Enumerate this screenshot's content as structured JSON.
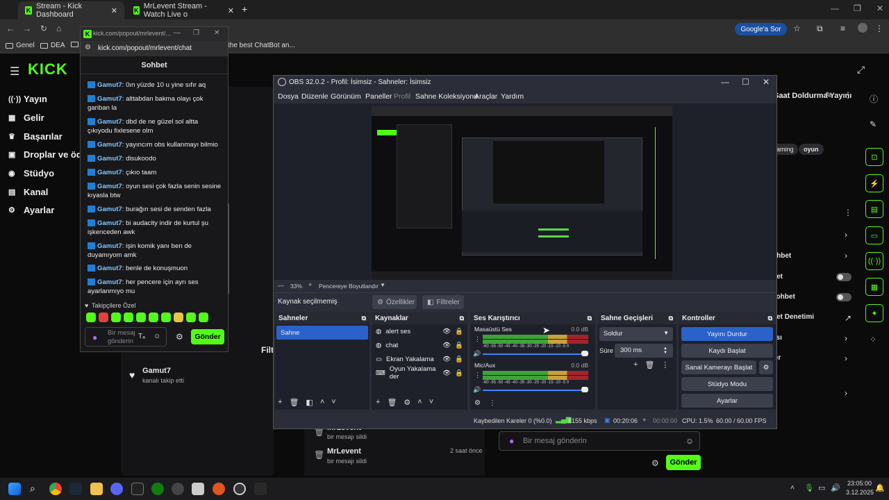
{
  "browser": {
    "tabs": [
      {
        "label": "Stream - Kick Dashboard"
      },
      {
        "label": "MrLevent Stream - Watch Live o"
      }
    ],
    "bookmarks": [
      "Genel",
      "DEA",
      "the best ChatBot an..."
    ],
    "google_btn": "Google'a Sor"
  },
  "popout": {
    "url_short": "kick.com/popout/mrlevent/...",
    "url": "kick.com/popout/mrlevent/chat",
    "title": "Sohbet",
    "messages": [
      {
        "user": "Gamut7",
        "text": ": 0ın yüzde 10 u yine sıfır aq"
      },
      {
        "user": "Gamut7",
        "text": ": alttabdan bakma olayı çok gariban la"
      },
      {
        "user": "Gamut7",
        "text": ": dbd de ne güzel sol altta çıkıyodu fixlesene olm"
      },
      {
        "user": "Gamut7",
        "text": ": yayıncım obs kullanmayı bilmio"
      },
      {
        "user": "Gamut7",
        "text": ": disukoodo"
      },
      {
        "user": "Gamut7",
        "text": ": çıkıo taam"
      },
      {
        "user": "Gamut7",
        "text": ": oyun sesi çok fazla senin sesine kıyasla btw"
      },
      {
        "user": "Gamut7",
        "text": ": burağın sesi de senden fazla"
      },
      {
        "user": "Gamut7",
        "text": ": bi audacity indir de kurtul şu işkenceden awk"
      },
      {
        "user": "Gamut7",
        "text": ": işin komik yanı ben de duyamıyom amk"
      },
      {
        "user": "Gamut7",
        "text": ": benle de konuşmuon"
      },
      {
        "user": "Gamut7",
        "text": ": her pencere için ayrı ses ayarlanmıyo mu"
      }
    ],
    "followers_label": "Takipçilere Özel",
    "input_placeholder": "Bir mesaj gönderin",
    "send": "Gönder"
  },
  "kick": {
    "logo": "KICK",
    "nav": [
      "Yayın",
      "Gelir",
      "Başarılar",
      "Droplar ve ödüll",
      "Stüdyo",
      "Kanal",
      "Ayarlar"
    ],
    "stream_title": "Saat Doldurma Yayını",
    "tags": [
      "aming",
      "oyun"
    ],
    "activity": [
      {
        "name": "Gamut7",
        "desc": "kanalı takip etti",
        "time": ""
      },
      {
        "name": "MrLevent",
        "desc": "bir mesajı sildi",
        "time": ""
      },
      {
        "name": "MrLevent",
        "desc": "bir mesajı sildi",
        "time": "2 saat önce"
      }
    ],
    "filter_label": "Filtr",
    "right_panel": [
      "ohbet",
      "bet",
      "sohbet",
      "bet Denetimi",
      "ası",
      "ler"
    ],
    "chat_placeholder": "Bir mesaj gönderin",
    "send": "Gönder"
  },
  "obs": {
    "title": "OBS 32.0.2 - Profil: İsimsiz - Sahneler: İsimsiz",
    "menu": [
      "Dosya",
      "Düzenle",
      "Görünüm",
      "Paneller",
      "Profil",
      "Sahne Koleksiyonu",
      "Araçlar",
      "Yardım"
    ],
    "zoom": "33%",
    "fit": "Pencereye Boyutlandır",
    "no_source": "Kaynak seçilmemiş",
    "properties": "Özellikler",
    "filters": "Filtreler",
    "scenes_title": "Sahneler",
    "scenes": [
      "Sahne"
    ],
    "sources_title": "Kaynaklar",
    "sources": [
      {
        "name": "alert ses",
        "icon": "globe-icon"
      },
      {
        "name": "chat",
        "icon": "globe-icon"
      },
      {
        "name": "Ekran Yakalama",
        "icon": "monitor-icon"
      },
      {
        "name": "Oyun Yakalama der",
        "icon": "gamepad-icon"
      }
    ],
    "mixer_title": "Ses Karıştırıcı",
    "mixer": [
      {
        "name": "Masaüstü Ses",
        "db": "0.0 dB"
      },
      {
        "name": "Mic/Aux",
        "db": "0.0 dB"
      }
    ],
    "scale": "-60 -55 -50 -45 -40 -35 -30 -25 -20 -15 -10 -5 0",
    "transitions_title": "Sahne Geçişleri",
    "transition": "Soldur",
    "duration_label": "Süre",
    "duration": "300 ms",
    "controls_title": "Kontroller",
    "controls": [
      "Yayını Durdur",
      "Kaydı Başlat",
      "Sanal Kamerayı Başlat",
      "Stüdyo Modu",
      "Ayarlar"
    ],
    "status": {
      "dropped": "Kaybedilen Kareler 0 (%0.0)",
      "kbps": "8155 kbps",
      "live": "00:20:06",
      "rec": "00:00:00",
      "cpu": "CPU: 1.5%",
      "fps": "60.00 / 60.00 FPS"
    }
  },
  "taskbar": {
    "time": "23:05:00",
    "date": "3.12.2025"
  }
}
